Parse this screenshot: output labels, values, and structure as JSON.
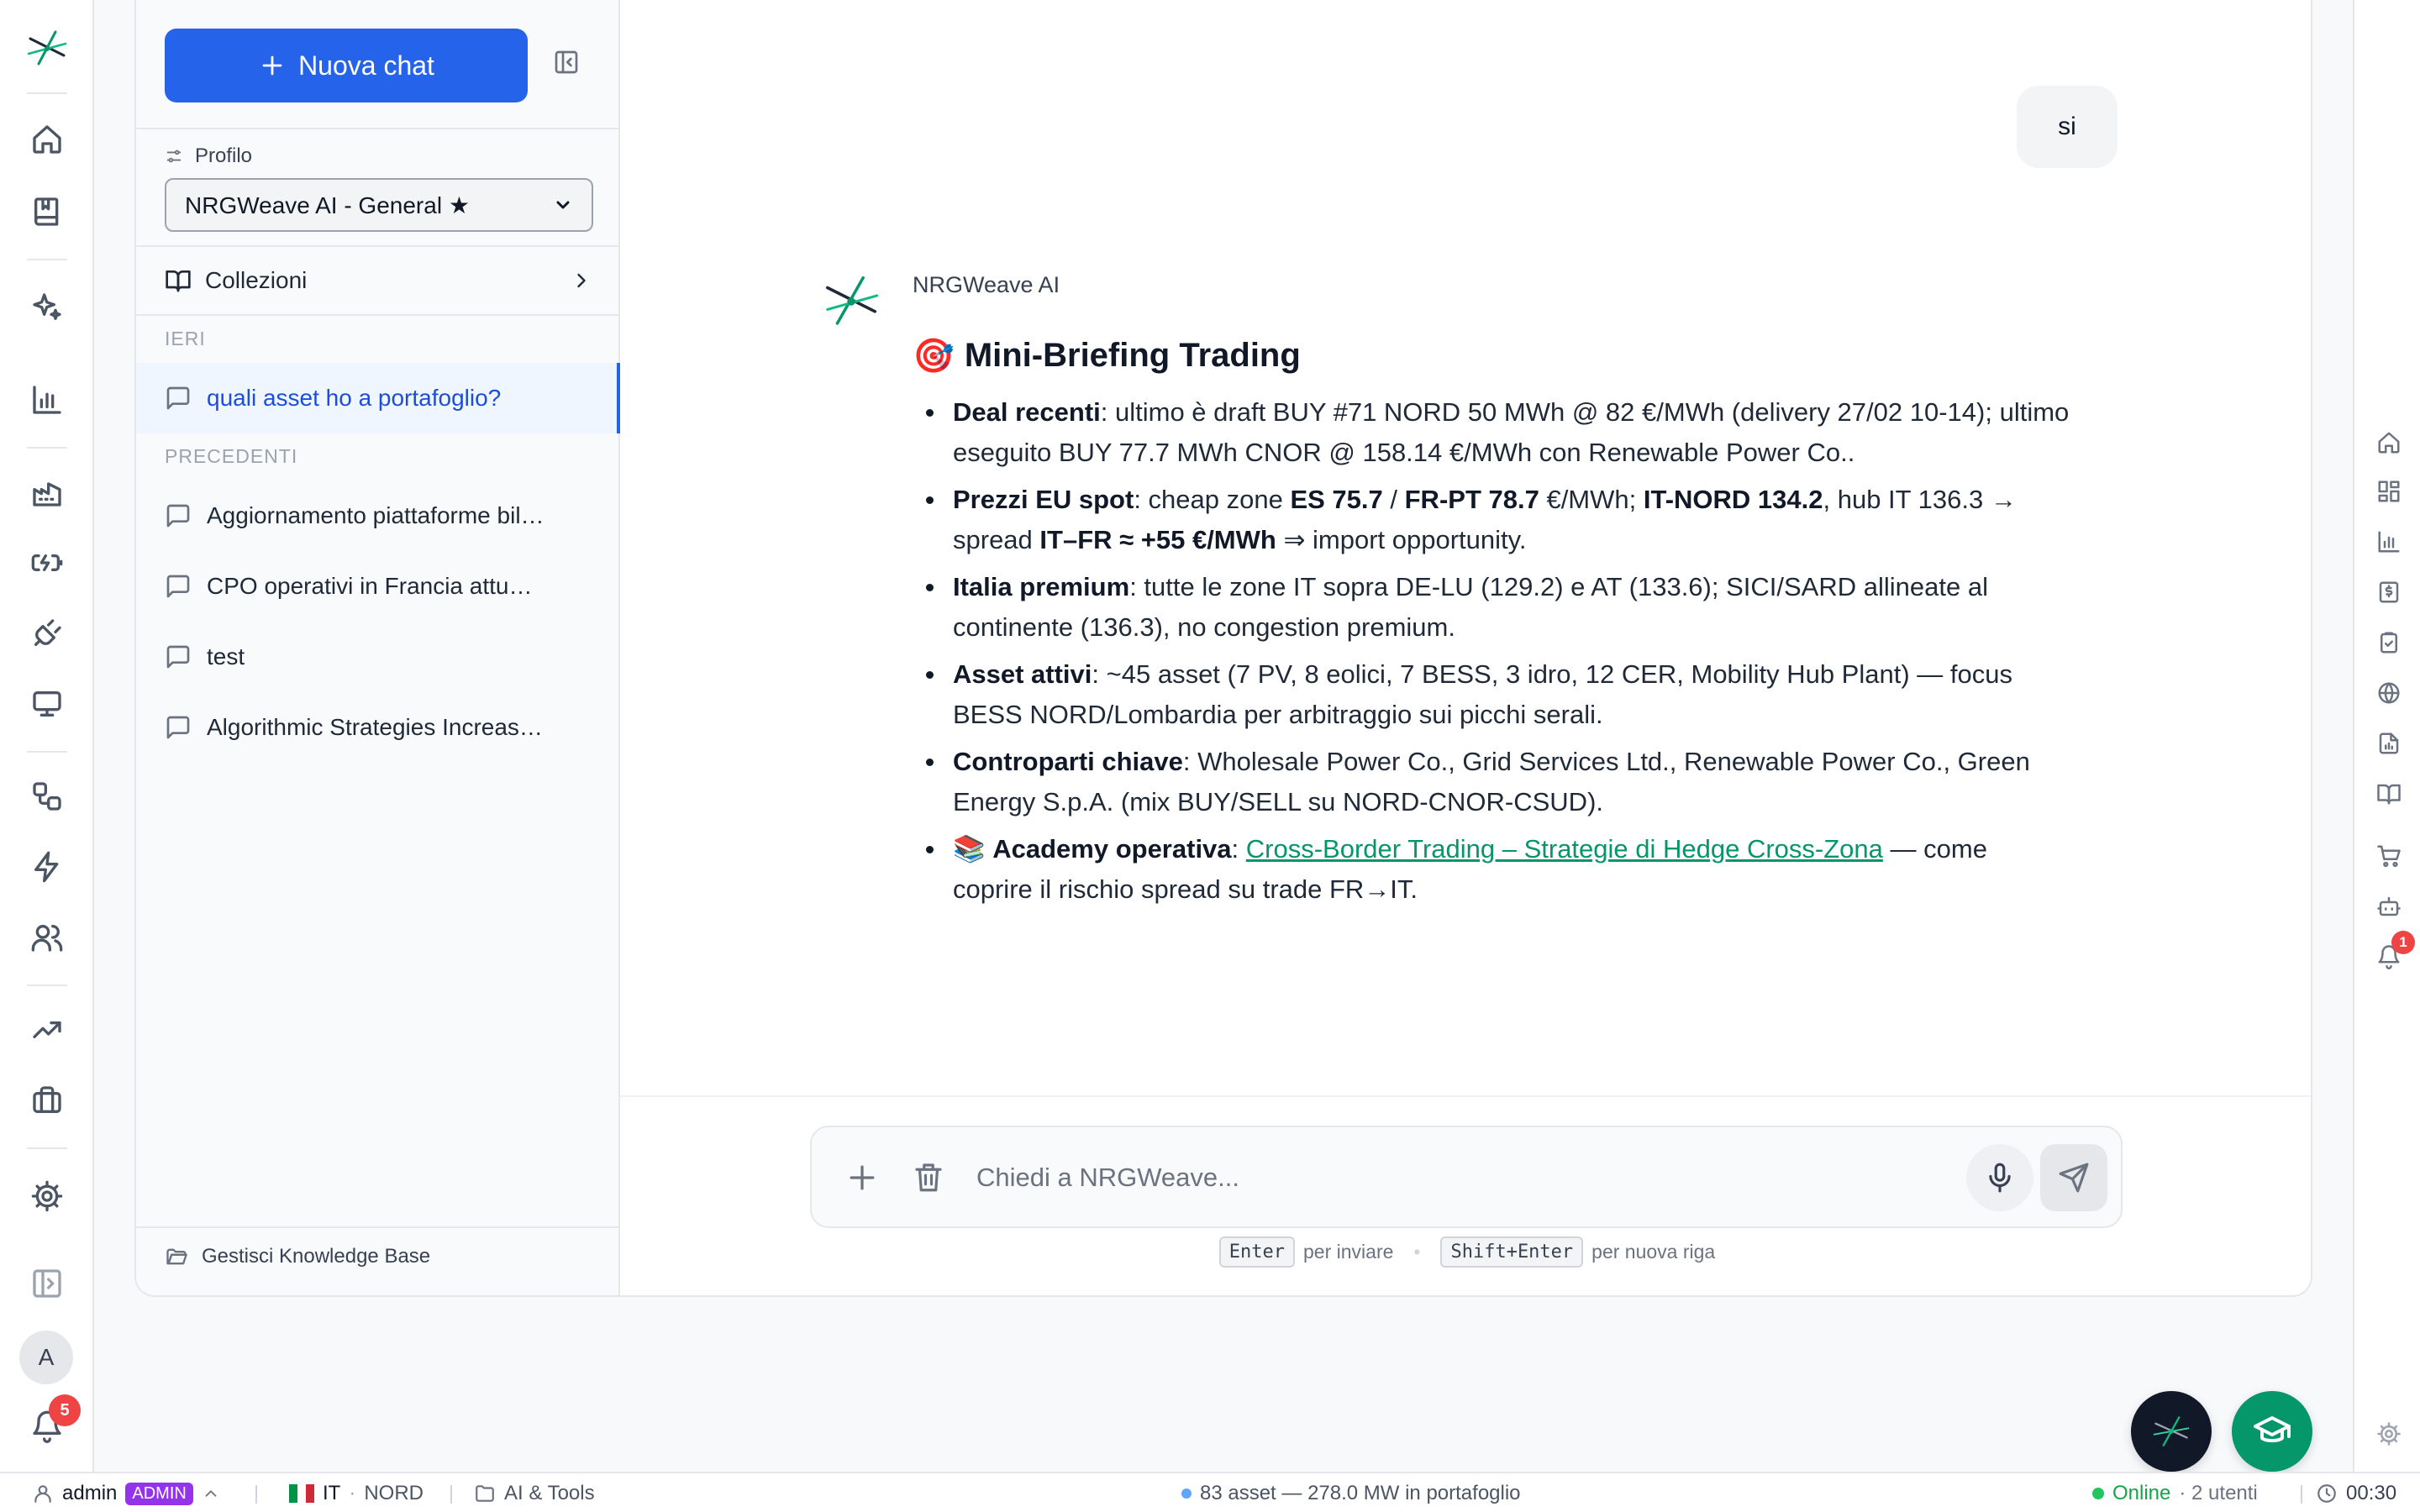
{
  "sidebar": {
    "new_chat_label": "Nuova chat",
    "profile_label": "Profilo",
    "profile_value": "NRGWeave AI - General ★",
    "collections_label": "Collezioni",
    "section_yesterday": "IERI",
    "section_previous": "PRECEDENTI",
    "chats_yesterday": [
      {
        "title": "quali asset ho a portafoglio?",
        "active": true
      }
    ],
    "chats_previous": [
      {
        "title": "Aggiornamento piattaforme bil…"
      },
      {
        "title": "CPO operativi in Francia attu…"
      },
      {
        "title": "test"
      },
      {
        "title": "Algorithmic Strategies Increas…"
      }
    ],
    "kb_label": "Gestisci Knowledge Base"
  },
  "rail": {
    "avatar_initial": "A",
    "notifications_count": "5"
  },
  "right_rail": {
    "notifications_count": "1"
  },
  "chat": {
    "user_message": "si",
    "assistant_name": "NRGWeave AI",
    "briefing": {
      "emoji": "🎯",
      "title": "Mini-Briefing Trading",
      "bullets": {
        "deal_label": "Deal recenti",
        "deal_text": ": ultimo è draft BUY #71 NORD 50 MWh @ 82 €/MWh (delivery 27/02 10-14); ultimo eseguito BUY 77.7 MWh CNOR @ 158.14 €/MWh con Renewable Power Co..",
        "prices_label": "Prezzi EU spot",
        "prices_t1": ": cheap zone ",
        "prices_es": "ES 75.7",
        "prices_t2": " / ",
        "prices_fr": "FR-PT 78.7",
        "prices_t3": " €/MWh; ",
        "prices_it": "IT-NORD 134.2",
        "prices_t4": ", hub IT 136.3 → spread ",
        "prices_spread": "IT–FR ≈ +55 €/MWh",
        "prices_t5": " ⇒ import opportunity.",
        "italy_label": "Italia premium",
        "italy_text": ": tutte le zone IT sopra DE-LU (129.2) e AT (133.6); SICI/SARD allineate al continente (136.3), no congestion premium.",
        "assets_label": "Asset attivi",
        "assets_text": ": ~45 asset (7 PV, 8 eolici, 7 BESS, 3 idro, 12 CER, Mobility Hub Plant) — focus BESS NORD/Lombardia per arbitraggio sui picchi serali.",
        "cp_label": "Controparti chiave",
        "cp_text": ": Wholesale Power Co., Grid Services Ltd., Renewable Power Co., Green Energy S.p.A. (mix BUY/SELL su NORD-CNOR-CSUD).",
        "academy_emoji": "📚",
        "academy_label": "Academy operativa",
        "academy_colon": ": ",
        "academy_link": "Cross-Border Trading – Strategie di Hedge Cross-Zona",
        "academy_text": " — come coprire il rischio spread su trade FR→IT."
      }
    }
  },
  "composer": {
    "placeholder": "Chiedi a NRGWeave...",
    "hint_key1": "Enter",
    "hint_text1": "per inviare",
    "hint_sep": "•",
    "hint_key2": "Shift+Enter",
    "hint_text2": "per nuova riga"
  },
  "status_bar": {
    "user": "admin",
    "role_badge": "ADMIN",
    "country_code": "IT",
    "zone_sep": "·",
    "zone": "NORD",
    "workspace": "AI & Tools",
    "portfolio": "83 asset — 278.0 MW in portafoglio",
    "online": "Online",
    "users": "· 2 utenti",
    "time": "00:30"
  },
  "colors": {
    "primary": "#2563eb",
    "accent_green": "#059669",
    "admin_purple": "#9333ea",
    "badge_red": "#ef4444",
    "online_green": "#22c55e"
  }
}
